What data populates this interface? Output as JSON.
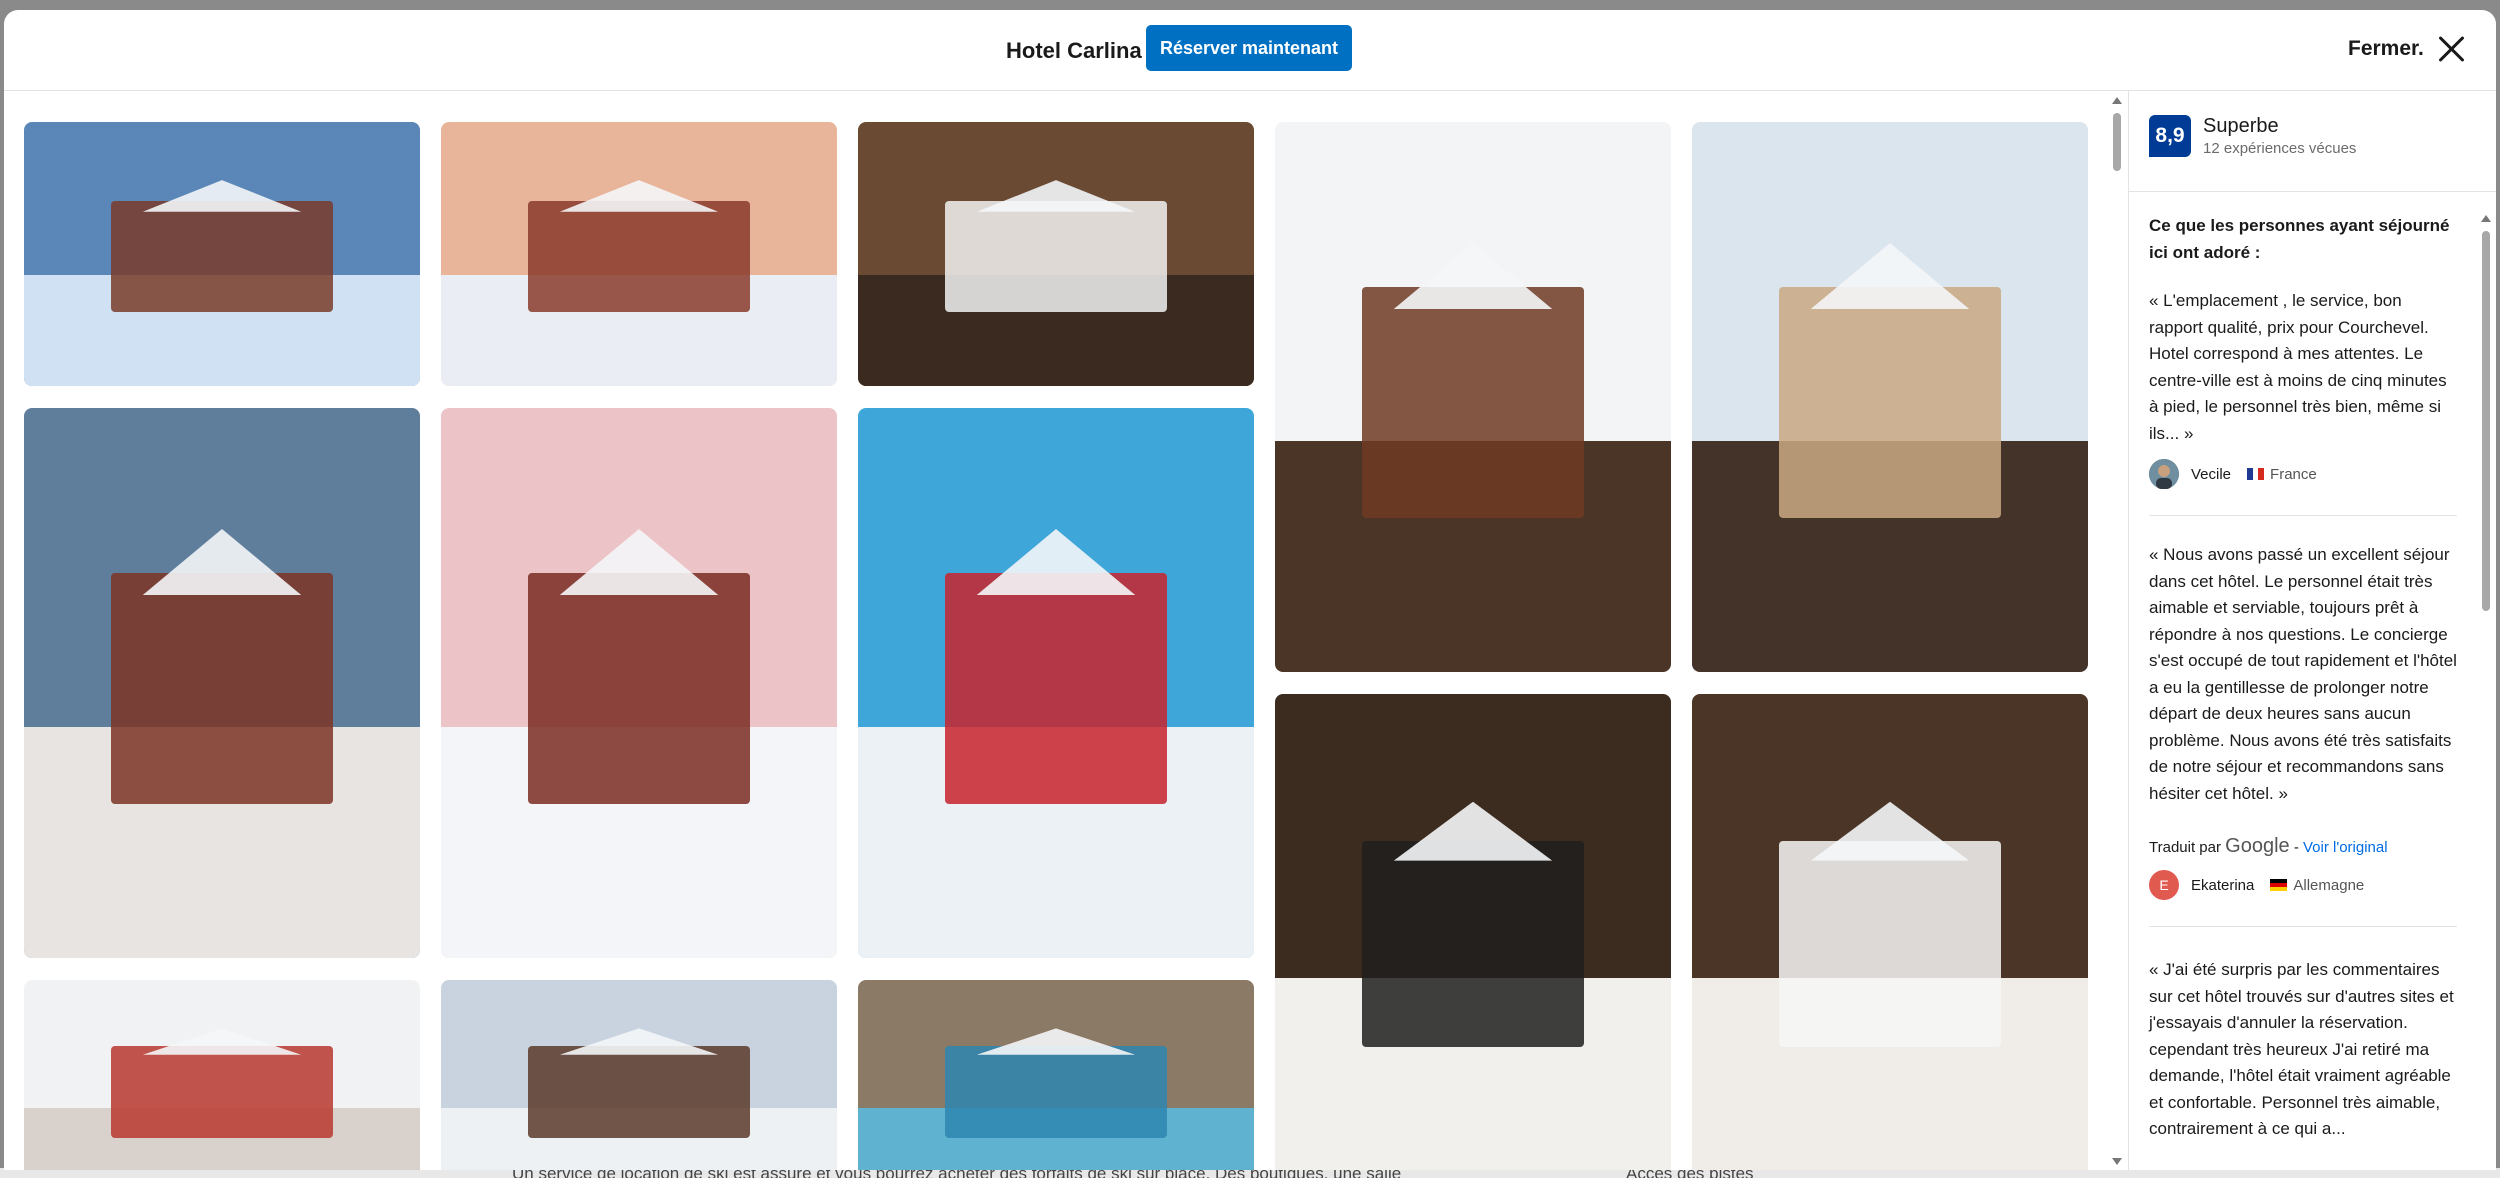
{
  "background_page": {
    "text_left": "Un service de location de ski est assuré et vous pourrez acheter des forfaits de ski sur place. Des boutiques, une salle",
    "text_right": "Accès des pistes"
  },
  "header": {
    "hotel_name": "Hotel Carlina",
    "book_button": "Réserver maintenant",
    "close_label": "Fermer."
  },
  "gallery": {
    "photos": [
      {
        "name": "photo-chalet-pines",
        "sky": "#5a86b8",
        "ground": "#cfe1f2",
        "accent": "#7a3b2a"
      },
      {
        "name": "photo-village-sunset",
        "sky": "#e9b59a",
        "ground": "#eaeef4",
        "accent": "#8a3a2c"
      },
      {
        "name": "photo-room-window",
        "sky": "#6b4a33",
        "ground": "#3b2a1f",
        "accent": "#f2f2f2"
      },
      {
        "name": "photo-terrace-restaurant",
        "sky": "#f3f4f6",
        "ground": "#4b3526",
        "accent": "#6e3a24"
      },
      {
        "name": "photo-woman-snowy-balcony",
        "sky": "#dbe5ee",
        "ground": "#433329",
        "accent": "#c9a882"
      },
      {
        "name": "photo-woman-coffee-balcony",
        "sky": "#5e7e9c",
        "ground": "#e7e4e1",
        "accent": "#7d3426"
      },
      {
        "name": "photo-hotel-exterior-pink-sky",
        "sky": "#ecc4c8",
        "ground": "#f3f5f8",
        "accent": "#7a2c22"
      },
      {
        "name": "photo-ski-slope-deck",
        "sky": "#3fa6d9",
        "ground": "#ecf1f5",
        "accent": "#c8232c"
      },
      {
        "name": "photo-chef-serving-table",
        "sky": "#3c2b1f",
        "ground": "#f2f0ec",
        "accent": "#1f1f1f"
      },
      {
        "name": "photo-chef-crepes",
        "sky": "#4a3526",
        "ground": "#f0ede8",
        "accent": "#f6f6f6"
      },
      {
        "name": "photo-window-snowy-trees",
        "sky": "#f0f2f4",
        "ground": "#d9d2cc",
        "accent": "#b7382f"
      },
      {
        "name": "photo-outdoor-terrace-diners",
        "sky": "#c9d3df",
        "ground": "#eef1f4",
        "accent": "#5a3a2a"
      },
      {
        "name": "photo-indoor-pool",
        "sky": "#8a7a66",
        "ground": "#5fb3d1",
        "accent": "#2e86b0"
      }
    ]
  },
  "sidebar": {
    "score": "8,9",
    "score_word": "Superbe",
    "score_count": "12 expériences vécues",
    "loved_title": "Ce que les personnes ayant séjourné ici ont adoré :",
    "reviews": [
      {
        "text": "« L'emplacement , le service, bon rapport qualité, prix pour Courchevel. Hotel correspond à mes attentes. Le centre-ville est à moins de cinq minutes à pied, le personnel très bien, même si ils... »",
        "author": "Vecile",
        "country": "France"
      },
      {
        "text": "« Nous avons passé un excellent séjour dans cet hôtel. Le personnel était très aimable et serviable, toujours prêt à répondre à nos questions. Le concierge s'est occupé de tout rapidement et l'hôtel a eu la gentillesse de prolonger notre départ de deux heures sans aucun problème. Nous avons été très satisfaits de notre séjour et recommandons sans hésiter cet hôtel. »",
        "translated_prefix": "Traduit par",
        "translated_by": "Google",
        "translated_sep": " - ",
        "view_original": "Voir l'original",
        "author": "Ekaterina",
        "author_initial": "E",
        "country": "Allemagne"
      },
      {
        "text": "« J'ai été surpris par les commentaires sur cet hôtel trouvés sur d'autres sites et j'essayais d'annuler la réservation. cependant très heureux J'ai retiré ma demande, l'hôtel était vraiment agréable et confortable. Personnel très aimable, contrairement à ce qui a..."
      }
    ]
  }
}
